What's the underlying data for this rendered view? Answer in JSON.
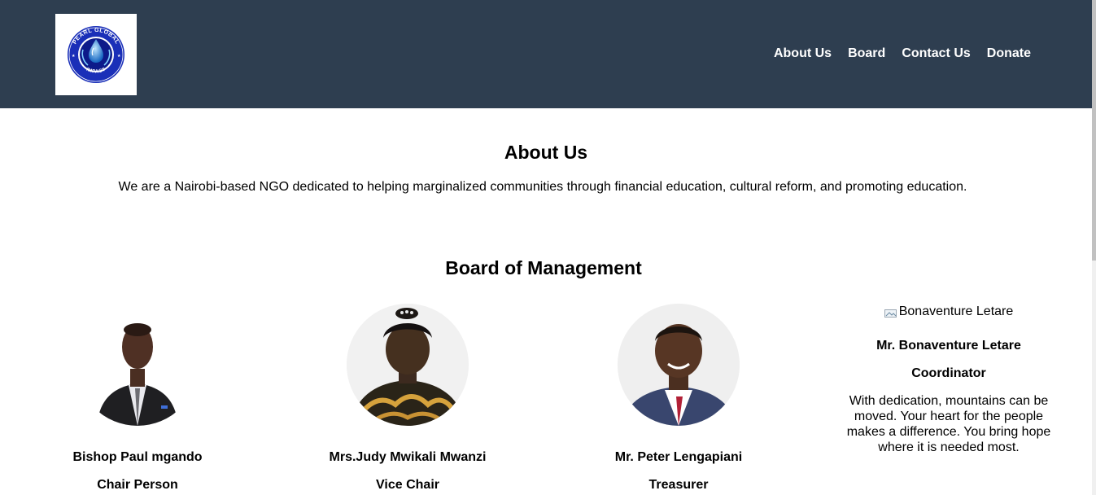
{
  "header": {
    "logo": {
      "ring_text_top": "PEARL GLOBAL",
      "ring_text_bottom": "IMPACT"
    },
    "nav": [
      "About Us",
      "Board",
      "Contact Us",
      "Donate"
    ]
  },
  "about": {
    "title": "About Us",
    "text": "We are a Nairobi-based NGO dedicated to helping marginalized communities through financial education, cultural reform, and promoting education."
  },
  "board": {
    "title": "Board of Management",
    "members": [
      {
        "name": "Bishop Paul mgando",
        "role": "Chair Person"
      },
      {
        "name": "Mrs.Judy Mwikali Mwanzi",
        "role": "Vice Chair"
      },
      {
        "name": "Mr. Peter Lengapiani",
        "role": "Treasurer"
      },
      {
        "name": "Mr. Bonaventure Letare",
        "role": "Coordinator",
        "image_alt": "Bonaventure Letare",
        "bio": "With dedication, mountains can be moved. Your heart for the people makes a difference. You bring hope where it is needed most."
      }
    ]
  },
  "colors": {
    "header_bg": "#2e3e50",
    "nav_text": "#ffffff",
    "logo_blue": "#1a2fb8"
  }
}
